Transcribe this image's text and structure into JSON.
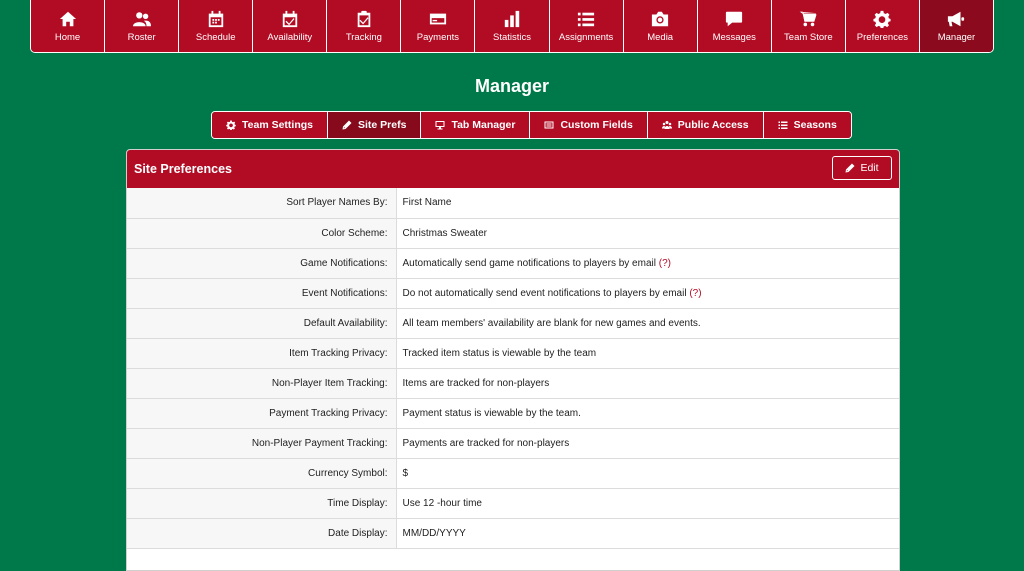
{
  "nav": [
    {
      "label": "Home",
      "icon": "home-icon"
    },
    {
      "label": "Roster",
      "icon": "users-icon"
    },
    {
      "label": "Schedule",
      "icon": "calendar-icon"
    },
    {
      "label": "Availability",
      "icon": "calendar-check-icon"
    },
    {
      "label": "Tracking",
      "icon": "clipboard-check-icon"
    },
    {
      "label": "Payments",
      "icon": "credit-card-icon"
    },
    {
      "label": "Statistics",
      "icon": "bar-chart-icon"
    },
    {
      "label": "Assignments",
      "icon": "list-icon"
    },
    {
      "label": "Media",
      "icon": "camera-icon"
    },
    {
      "label": "Messages",
      "icon": "chat-icon"
    },
    {
      "label": "Team Store",
      "icon": "cart-icon"
    },
    {
      "label": "Preferences",
      "icon": "gear-icon"
    },
    {
      "label": "Manager",
      "icon": "megaphone-icon"
    }
  ],
  "page": {
    "title": "Manager"
  },
  "subtabs": [
    {
      "label": "Team Settings",
      "icon": "gear-icon"
    },
    {
      "label": "Site Prefs",
      "icon": "pencil-icon"
    },
    {
      "label": "Tab Manager",
      "icon": "monitor-icon"
    },
    {
      "label": "Custom Fields",
      "icon": "form-icon"
    },
    {
      "label": "Public Access",
      "icon": "group-icon"
    },
    {
      "label": "Seasons",
      "icon": "list-icon"
    }
  ],
  "active_subtab": "Site Prefs",
  "panel": {
    "title": "Site Preferences",
    "edit_label": "Edit",
    "help_mark": "(?)",
    "rows": [
      {
        "label": "Sort Player Names By:",
        "value": "First Name"
      },
      {
        "label": "Color Scheme:",
        "value": "Christmas Sweater"
      },
      {
        "label": "Game Notifications:",
        "value": "Automatically send game notifications to players by email",
        "help": true
      },
      {
        "label": "Event Notifications:",
        "value": "Do not automatically send event notifications to players by email",
        "help": true
      },
      {
        "label": "Default Availability:",
        "value": "All team members' availability are blank for new games and events."
      },
      {
        "label": "Item Tracking Privacy:",
        "value": "Tracked item status is viewable by the team"
      },
      {
        "label": "Non-Player Item Tracking:",
        "value": "Items are tracked for non-players"
      },
      {
        "label": "Payment Tracking Privacy:",
        "value": "Payment status is viewable by the team."
      },
      {
        "label": "Non-Player Payment Tracking:",
        "value": "Payments are tracked for non-players"
      },
      {
        "label": "Currency Symbol:",
        "value": "$"
      },
      {
        "label": "Time Display:",
        "value": "Use 12 -hour time"
      },
      {
        "label": "Date Display:",
        "value": "MM/DD/YYYY"
      }
    ]
  },
  "colors": {
    "brand_red": "#b20c25",
    "background_green": "#00794a",
    "active_red": "#870a1c"
  }
}
